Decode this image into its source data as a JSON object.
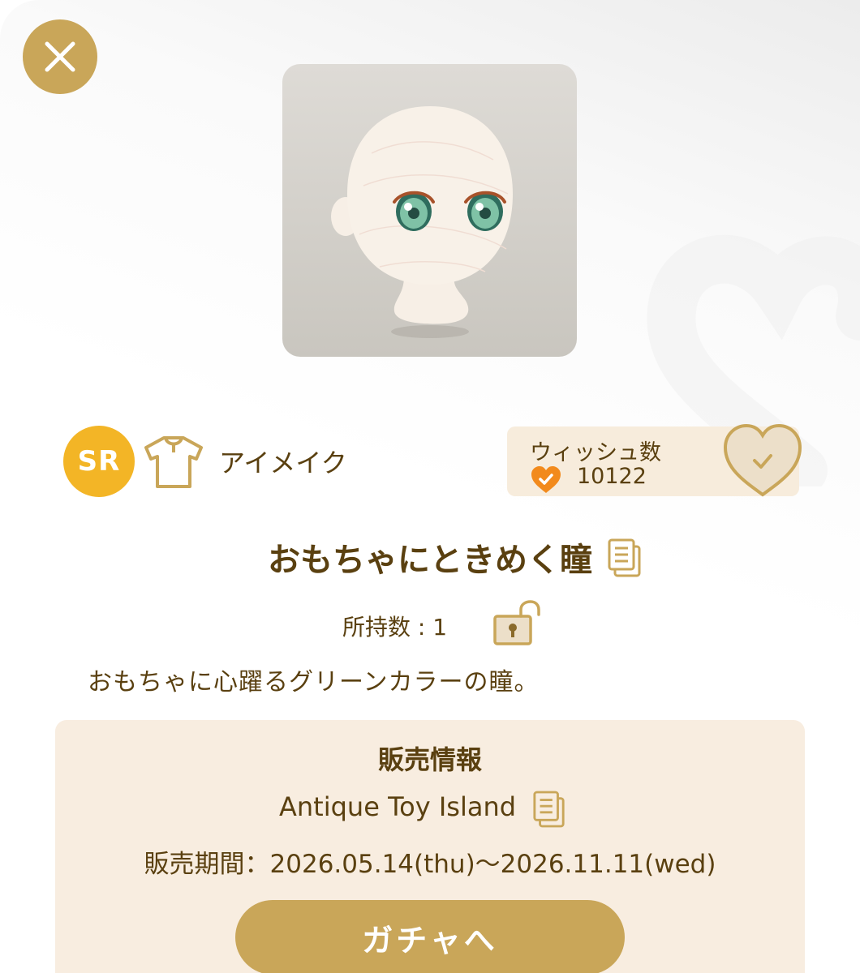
{
  "item": {
    "rarity": "SR",
    "category": "アイメイク",
    "category_icon": "shirt-icon",
    "name": "おもちゃにときめく瞳",
    "owned_text": "所持数 : 1",
    "description": "おもちゃに心躍るグリーンカラーの瞳。"
  },
  "wishlist": {
    "label": "ウィッシュ数",
    "count": "10122"
  },
  "sale_info": {
    "title": "販売情報",
    "gacha_name": "Antique Toy Island",
    "period": "販売期間：2026.05.14(thu)〜2026.11.11(wed)"
  },
  "actions": {
    "gacha_button": "ガチャへ"
  },
  "colors": {
    "accent_gold": "#c9a659",
    "rarity_yellow": "#f3b526",
    "text_brown": "#5a4010",
    "panel_cream": "#f8ede0",
    "wish_heart_orange": "#f28a1c"
  }
}
